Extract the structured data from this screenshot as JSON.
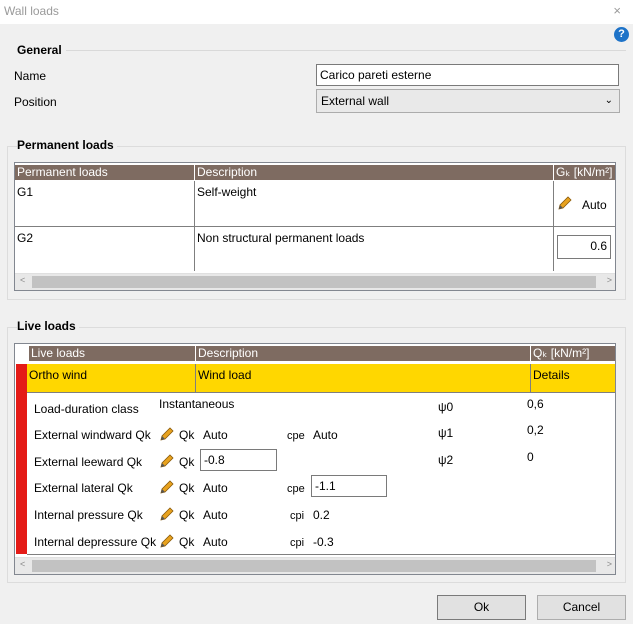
{
  "window": {
    "title": "Wall loads",
    "close_glyph": "×",
    "help_glyph": "?"
  },
  "general": {
    "title": "General",
    "name_label": "Name",
    "name_value": "Carico pareti esterne",
    "position_label": "Position",
    "position_value": "External wall"
  },
  "permanent": {
    "title": "Permanent loads",
    "headers": [
      "Permanent loads",
      "Description",
      "Gₖ [kN/m²]"
    ],
    "rows": [
      {
        "load": "G1",
        "description": "Self-weight",
        "value": "Auto"
      },
      {
        "load": "G2",
        "description": "Non structural permanent loads",
        "value": "0.6"
      }
    ]
  },
  "live": {
    "title": "Live loads",
    "headers": [
      "Live loads",
      "Description",
      "Qₖ [kN/m²]"
    ],
    "row": {
      "load": "Ortho wind",
      "description": "Wind load",
      "details": "Details"
    },
    "duration_label": "Load-duration class",
    "duration_value": "Instantaneous",
    "qk_label": "Qk",
    "params": [
      {
        "label": "External windward Qk",
        "value": "Auto",
        "coef_label": "cpe",
        "coef_value": "Auto"
      },
      {
        "label": "External leeward Qk",
        "value": "-0.8"
      },
      {
        "label": "External lateral Qk",
        "value": "Auto",
        "coef_label": "cpe",
        "coef_value": "-1.1"
      },
      {
        "label": "Internal pressure Qk",
        "value": "Auto",
        "coef_label": "cpi",
        "coef_value": "0.2"
      },
      {
        "label": "Internal depressure Qk",
        "value": "Auto",
        "coef_label": "cpi",
        "coef_value": "-0.3"
      }
    ],
    "psi": [
      {
        "label": "ψ0",
        "value": "0,6"
      },
      {
        "label": "ψ1",
        "value": "0,2"
      },
      {
        "label": "ψ2",
        "value": "0"
      }
    ]
  },
  "buttons": {
    "ok": "Ok",
    "cancel": "Cancel"
  },
  "colors": {
    "header": "#7e6b61",
    "highlight": "#ffd700",
    "marker": "#e41b17"
  },
  "icons": {
    "edit": "pencil-icon",
    "help": "help-icon",
    "close": "close-icon"
  }
}
